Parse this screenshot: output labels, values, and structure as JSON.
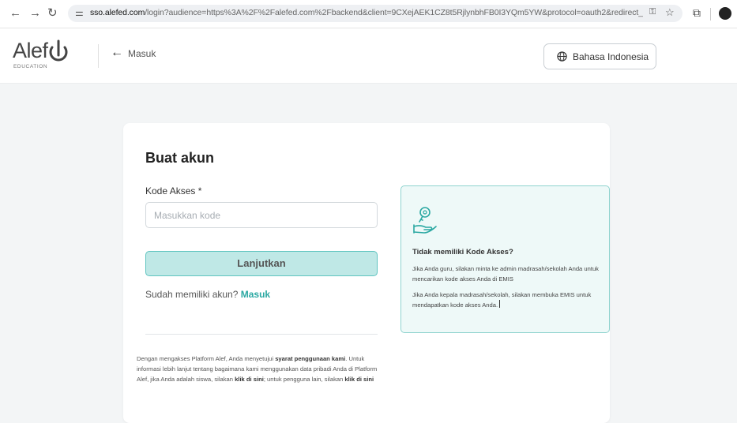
{
  "browser": {
    "url_host": "sso.alefed.com",
    "url_path": "/login?audience=https%3A%2F%2Falefed.com%2Fbackend&client=9CXejAEK1CZ8t5RjlynbhFB0I3YQm5YW&protocol=oauth2&redirect_uri=https..."
  },
  "header": {
    "logo_word": "Alef",
    "logo_sub": "EDUCATION",
    "back_label": "Masuk",
    "language": "Bahasa Indonesia"
  },
  "form": {
    "title": "Buat akun",
    "field_label": "Kode Akses *",
    "field_placeholder": "Masukkan kode",
    "continue_label": "Lanjutkan",
    "have_account": "Sudah memiliki akun?",
    "login_link": "Masuk",
    "terms": {
      "p1": "Dengan mengakses Platform Alef, Anda menyetujui ",
      "b1": "syarat penggunaan kami",
      "p2": ". Untuk informasi lebih lanjut tentang bagaimana kami menggunakan data pribadi Anda di Platform Alef, jika Anda adalah siswa, silakan ",
      "b2": "klik di sini",
      "p3": "; untuk pengguna lain, silakan ",
      "b3": "klik di sini"
    }
  },
  "info": {
    "title": "Tidak memiliki Kode Akses?",
    "p1": "Jika Anda guru, silakan minta ke admin madrasah/sekolah Anda untuk mencarikan kode akses Anda di EMIS",
    "p2": "Jika Anda kepala madrasah/sekolah, silakan membuka EMIS untuk mendapatkan kode akses Anda."
  },
  "colors": {
    "accent": "#2aa8a2",
    "button_bg": "#bfe8e6",
    "info_bg": "#eef9f8"
  }
}
